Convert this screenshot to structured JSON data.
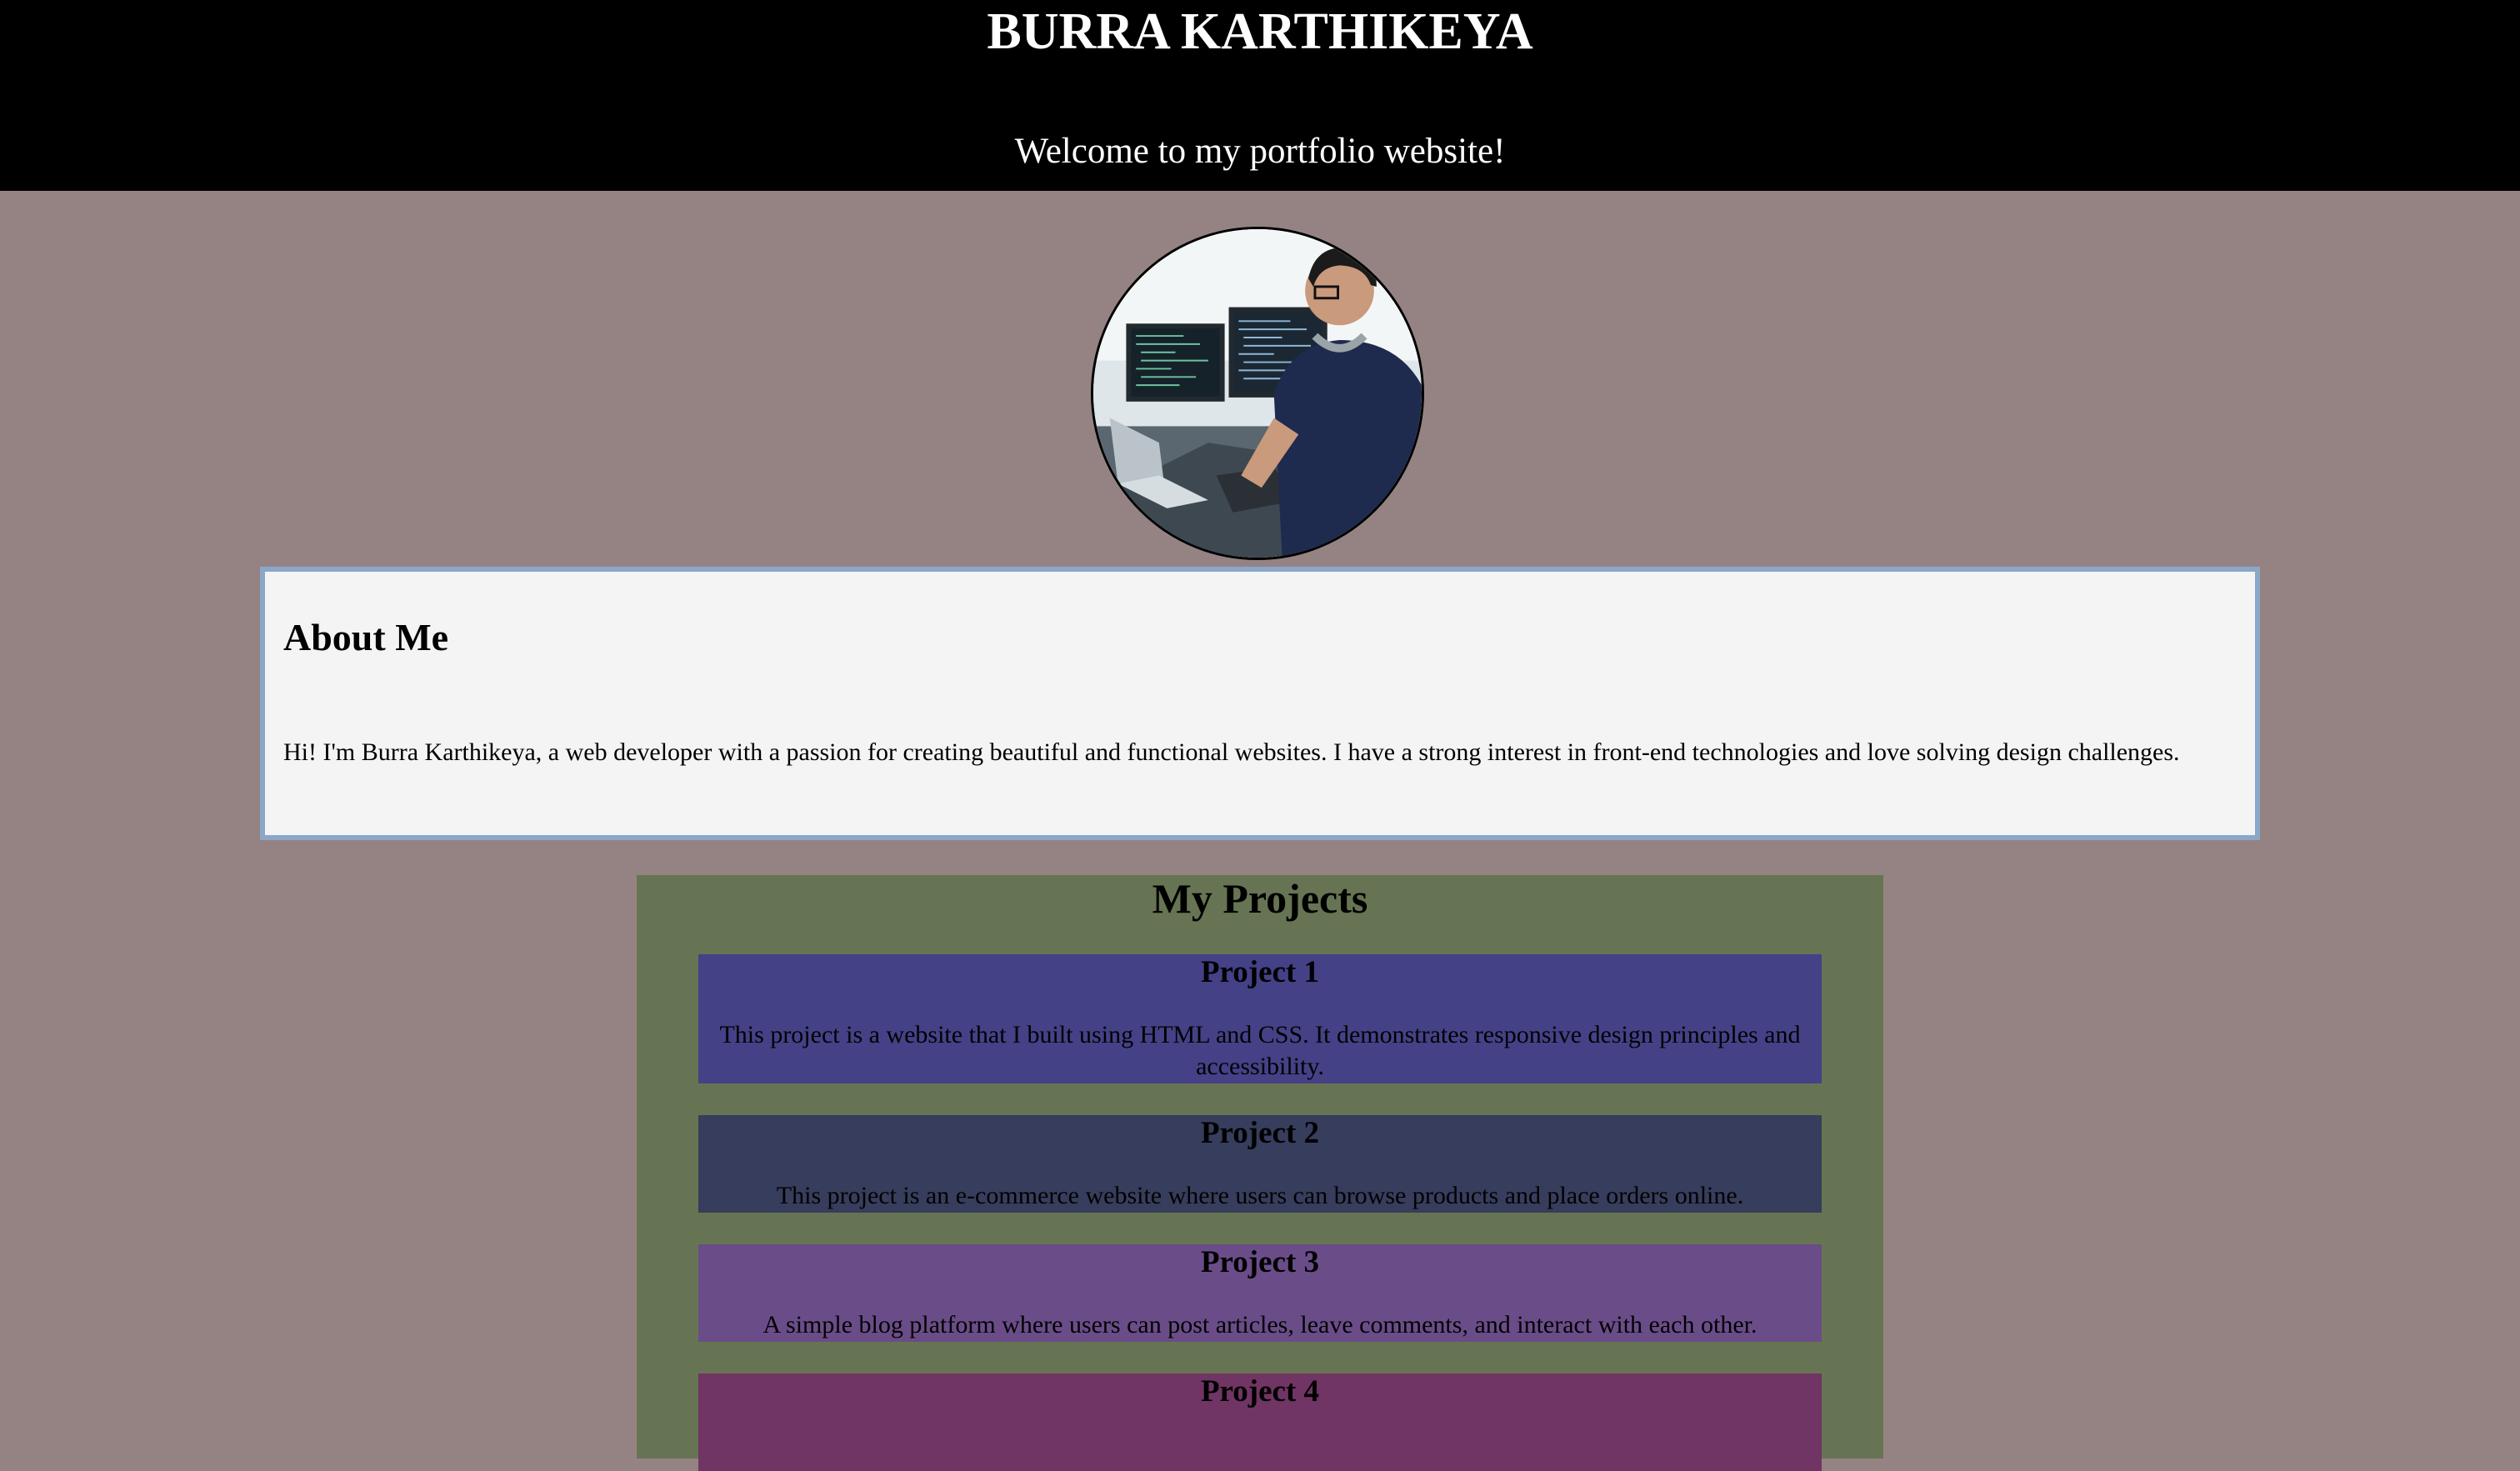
{
  "header": {
    "name": "BURRA KARTHIKEYA",
    "welcome": "Welcome to my portfolio website!"
  },
  "avatar": {
    "description": "profile-photo"
  },
  "about": {
    "heading": "About Me",
    "text": "Hi! I'm Burra Karthikeya, a web developer with a passion for creating beautiful and functional websites. I have a strong interest in front-end technologies and love solving design challenges."
  },
  "projects": {
    "heading": "My Projects",
    "items": [
      {
        "title": "Project 1",
        "description": "This project is a website that I built using HTML and CSS. It demonstrates responsive design principles and accessibility.",
        "color": "#444187"
      },
      {
        "title": "Project 2",
        "description": "This project is an e-commerce website where users can browse products and place orders online.",
        "color": "#373d5c"
      },
      {
        "title": "Project 3",
        "description": "A simple blog platform where users can post articles, leave comments, and interact with each other.",
        "color": "#6a4d88"
      },
      {
        "title": "Project 4",
        "color": "#703564"
      }
    ]
  },
  "colors": {
    "page_background": "#958383",
    "header_background": "#000000",
    "about_background": "#f4f4f4",
    "about_border": "#8aa7c8",
    "projects_background": "#677453"
  }
}
